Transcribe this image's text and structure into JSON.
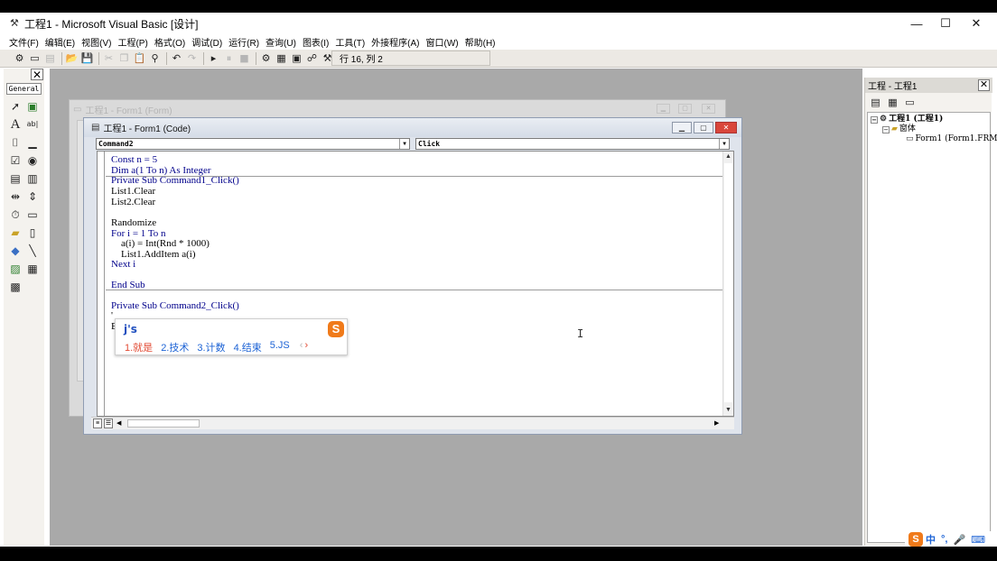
{
  "window": {
    "title": "工程1 - Microsoft Visual Basic [设计]",
    "minimize": "—",
    "maximize": "☐",
    "close": "✕"
  },
  "menu": [
    "文件(F)",
    "编辑(E)",
    "视图(V)",
    "工程(P)",
    "格式(O)",
    "调试(D)",
    "运行(R)",
    "查询(U)",
    "图表(I)",
    "工具(T)",
    "外接程序(A)",
    "窗口(W)",
    "帮助(H)"
  ],
  "toolbar": {
    "position": "行 16, 列 2"
  },
  "toolbox": {
    "close": "✕",
    "tab": "General"
  },
  "form_window": {
    "title": "工程1 - Form1 (Form)"
  },
  "code_window": {
    "title": "工程1 - Form1 (Code)",
    "object_combo": "Command2",
    "proc_combo": "Click",
    "lines": [
      {
        "text": "Const n = 5"
      },
      {
        "text": "Dim a(1 To n) As Integer"
      },
      {
        "text": "Private Sub Command1_Click()"
      },
      {
        "text": "List1.Clear"
      },
      {
        "text": "List2.Clear"
      },
      {
        "text": ""
      },
      {
        "text": "Randomize"
      },
      {
        "text": "For i = 1 To n"
      },
      {
        "text": "    a(i) = Int(Rnd * 1000)"
      },
      {
        "text": "    List1.AddItem a(i)"
      },
      {
        "text": "Next i"
      },
      {
        "text": ""
      },
      {
        "text": "End Sub"
      },
      {
        "text": ""
      },
      {
        "text": "Private Sub Command2_Click()"
      },
      {
        "text": "'"
      },
      {
        "text": ""
      },
      {
        "text": "E"
      }
    ]
  },
  "ime": {
    "composition": "j's",
    "candidates": [
      "1.就是",
      "2.技术",
      "3.计数",
      "4.结束",
      "5.JS"
    ],
    "prev": "‹",
    "next": "›",
    "logo": "S"
  },
  "project": {
    "title": "工程 - 工程1",
    "close": "✕",
    "tree": {
      "root": "工程1 (工程1)",
      "folder": "窗体",
      "item": "Form1 (Form1.FRM)"
    }
  },
  "tray": {
    "logo": "S",
    "items": [
      "中",
      "°,",
      "🎤",
      "⌨"
    ]
  },
  "colors": {
    "keyword": "#00008b",
    "ime_accent": "#e24a33",
    "ime_candidate": "#1d63d5"
  }
}
